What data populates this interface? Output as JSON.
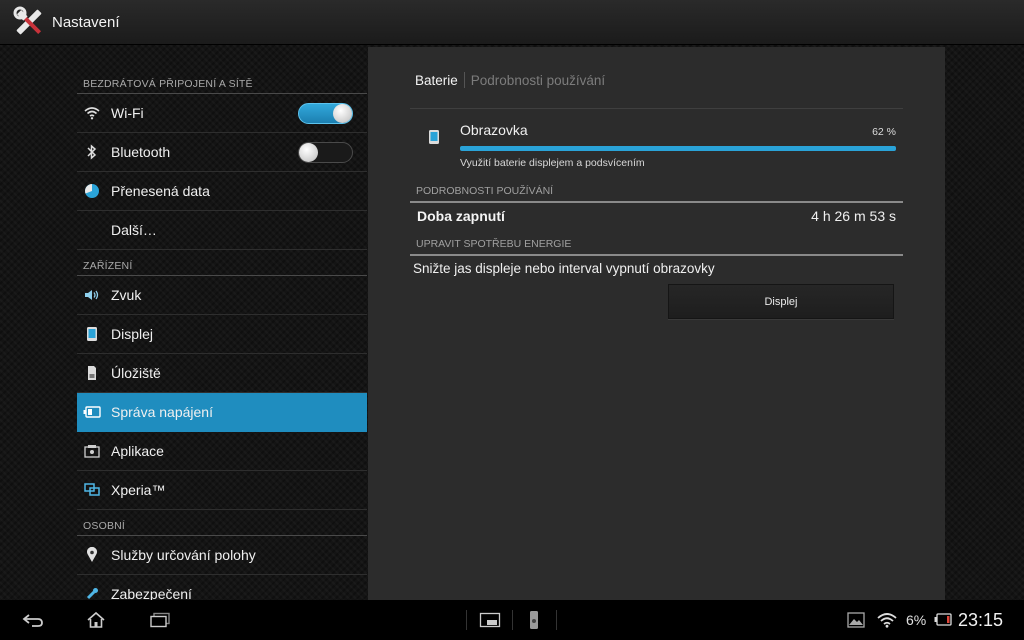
{
  "app": {
    "title": "Nastavení",
    "icon": "settings-tools-icon"
  },
  "sidebar": {
    "sections": [
      {
        "header": "BEZDRÁTOVÁ PŘIPOJENÍ A SÍTĚ",
        "items": [
          {
            "label": "Wi-Fi",
            "icon": "wifi-icon",
            "toggle": "on"
          },
          {
            "label": "Bluetooth",
            "icon": "bluetooth-icon",
            "toggle": "off"
          },
          {
            "label": "Přenesená data",
            "icon": "data-usage-icon"
          },
          {
            "label": "Další…"
          }
        ]
      },
      {
        "header": "ZAŘÍZENÍ",
        "items": [
          {
            "label": "Zvuk",
            "icon": "speaker-icon"
          },
          {
            "label": "Displej",
            "icon": "display-icon"
          },
          {
            "label": "Úložiště",
            "icon": "storage-icon"
          },
          {
            "label": "Správa napájení",
            "icon": "battery-icon",
            "selected": true
          },
          {
            "label": "Aplikace",
            "icon": "apps-icon"
          },
          {
            "label": "Xperia™",
            "icon": "xperia-icon"
          }
        ]
      },
      {
        "header": "OSOBNÍ",
        "items": [
          {
            "label": "Služby určování polohy",
            "icon": "location-pin-icon"
          },
          {
            "label": "Zabezpečení",
            "icon": "lock-icon"
          }
        ]
      }
    ]
  },
  "panel": {
    "tab_active": "Baterie",
    "tab_inactive": "Podrobnosti používání",
    "entry": {
      "title": "Obrazovka",
      "percent_text": "62 %",
      "bar_fraction": 1.0,
      "description": "Využití baterie displejem a podsvícením"
    },
    "usage_header": "PODROBNOSTI POUŽÍVÁNÍ",
    "on_time_label": "Doba zapnutí",
    "on_time_value": "4 h 26 m 53 s",
    "energy_header": "UPRAVIT SPOTŘEBU ENERGIE",
    "energy_tip": "Snižte jas displeje nebo interval vypnutí obrazovky",
    "display_button": "Displej"
  },
  "statusbar": {
    "battery": "6%",
    "time": "23:15"
  },
  "colors": {
    "accent": "#1f8dbf",
    "progress": "#2aa3d8"
  }
}
